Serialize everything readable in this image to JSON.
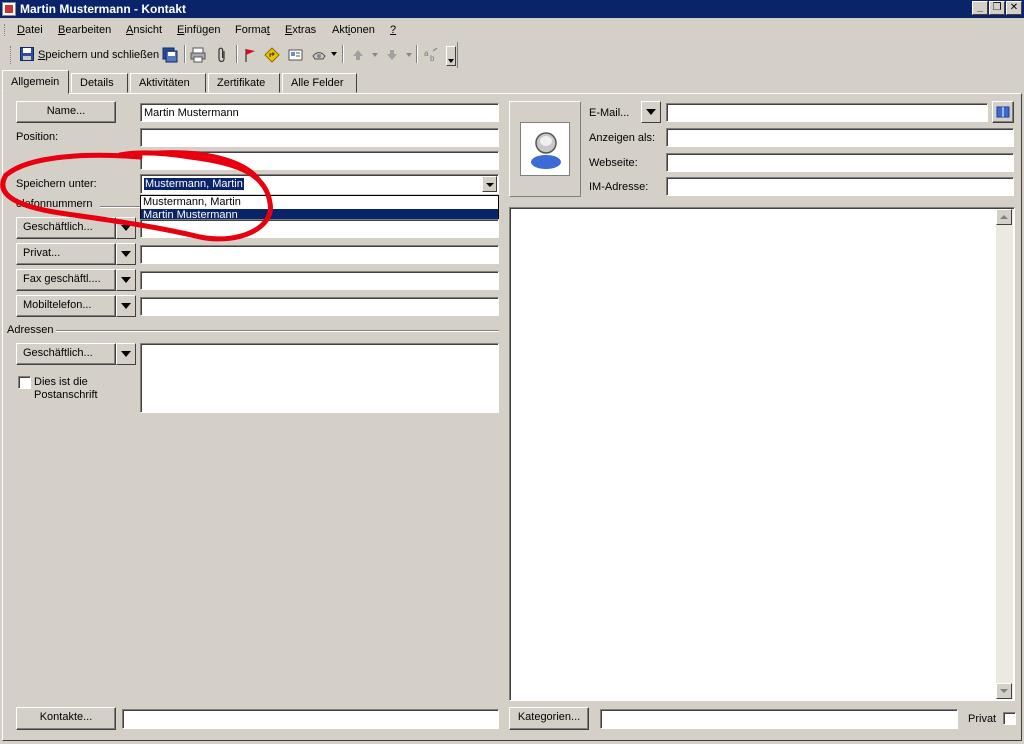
{
  "window": {
    "title": "Martin Mustermann - Kontakt"
  },
  "menu": [
    {
      "pre": "",
      "u": "D",
      "post": "atei"
    },
    {
      "pre": "",
      "u": "B",
      "post": "earbeiten"
    },
    {
      "pre": "",
      "u": "A",
      "post": "nsicht"
    },
    {
      "pre": "",
      "u": "E",
      "post": "infügen"
    },
    {
      "pre": "Forma",
      "u": "t",
      "post": ""
    },
    {
      "pre": "",
      "u": "E",
      "post": "xtras"
    },
    {
      "pre": "Akt",
      "u": "i",
      "post": "onen"
    },
    {
      "pre": "",
      "u": "?",
      "post": ""
    }
  ],
  "toolbar": {
    "save_close_pre": "",
    "save_close_u": "S",
    "save_close_post": "peichern und schließen"
  },
  "tabs": [
    "Allgemein",
    "Details",
    "Aktivitäten",
    "Zertifikate",
    "Alle Felder"
  ],
  "left": {
    "name_button": "Name...",
    "name_value": "Martin Mustermann",
    "position_label": "Position:",
    "saveas_label": "Speichern unter:",
    "saveas_value": "Mustermann, Martin",
    "saveas_options": [
      "Mustermann, Martin",
      "Martin Mustermann"
    ],
    "phone_section": "elefonnummern",
    "phones": [
      "Geschäftlich...",
      "Privat...",
      "Fax geschäftl....",
      "Mobiltelefon..."
    ],
    "address_section": "Adressen",
    "address_button": "Geschäftlich...",
    "postal_line1": "Dies ist die",
    "postal_line2": "Postanschrift"
  },
  "right": {
    "email_button": "E-Mail...",
    "display_as_label": "Anzeigen als:",
    "website_label": "Webseite:",
    "im_label": "IM-Adresse:"
  },
  "bottom": {
    "contacts_button": "Kontakte...",
    "categories_button": "Kategorien...",
    "private_label": "Privat"
  },
  "colors": {
    "titlebar": "#0a246a",
    "face": "#d4d0c8",
    "annotation": "#e8000e"
  }
}
